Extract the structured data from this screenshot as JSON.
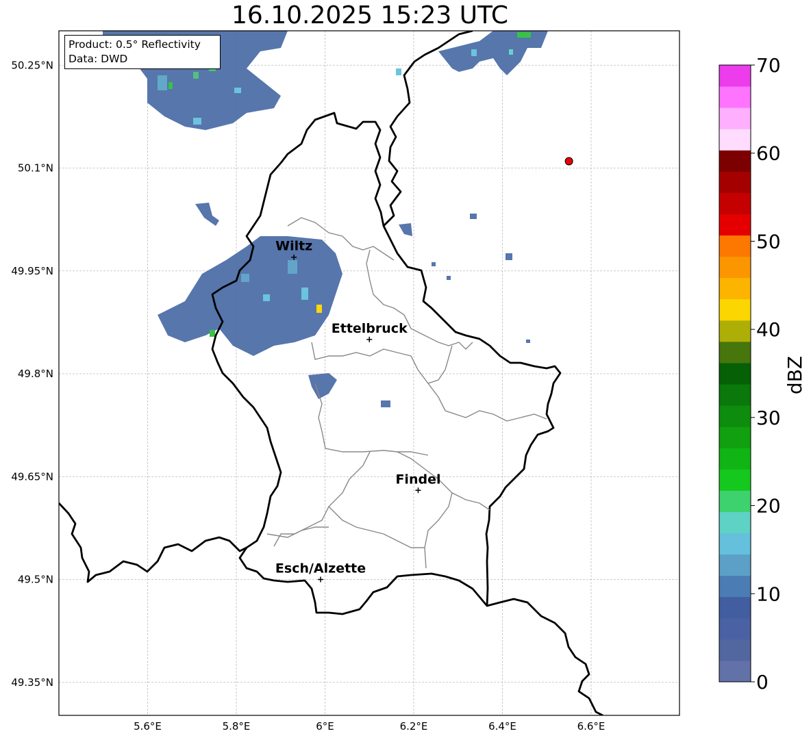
{
  "title": "16.10.2025 15:23 UTC",
  "info": {
    "product": "Product: 0.5° Reflectivity",
    "source": "Data: DWD"
  },
  "map": {
    "lon_range": [
      5.4,
      6.8
    ],
    "lat_range": [
      49.3,
      50.3
    ],
    "lat_ticks": [
      "50.25°N",
      "50.1°N",
      "49.95°N",
      "49.8°N",
      "49.65°N",
      "49.5°N",
      "49.35°N"
    ],
    "lon_ticks": [
      "5.6°E",
      "5.8°E",
      "6°E",
      "6.2°E",
      "6.4°E",
      "6.6°E"
    ],
    "grid": true,
    "cities": [
      {
        "name": "Wiltz",
        "lon": 5.93,
        "lat": 49.97
      },
      {
        "name": "Ettelbruck",
        "lon": 6.1,
        "lat": 49.85
      },
      {
        "name": "Findel",
        "lon": 6.21,
        "lat": 49.63
      },
      {
        "name": "Esch/Alzette",
        "lon": 5.99,
        "lat": 49.5
      }
    ],
    "marker": {
      "lon": 6.55,
      "lat": 50.11,
      "color": "#e8000b"
    }
  },
  "colorbar": {
    "label": "dBZ",
    "ticks": [
      "0",
      "10",
      "20",
      "30",
      "40",
      "50",
      "60",
      "70"
    ],
    "colors": [
      "#6272a8",
      "#5266a0",
      "#4a62a4",
      "#425ea0",
      "#4c7cb4",
      "#5ca0c8",
      "#64c0dc",
      "#5ed2c4",
      "#3ed26e",
      "#14c81e",
      "#10b414",
      "#10a010",
      "#0e8c0e",
      "#0a780a",
      "#066006",
      "#46760c",
      "#aeaf06",
      "#fcd600",
      "#fcb400",
      "#fc9600",
      "#fc7800",
      "#e40000",
      "#c40000",
      "#a40000",
      "#7c0000",
      "#fedcfe",
      "#feb0fe",
      "#fe74fe",
      "#ec3cec"
    ]
  }
}
